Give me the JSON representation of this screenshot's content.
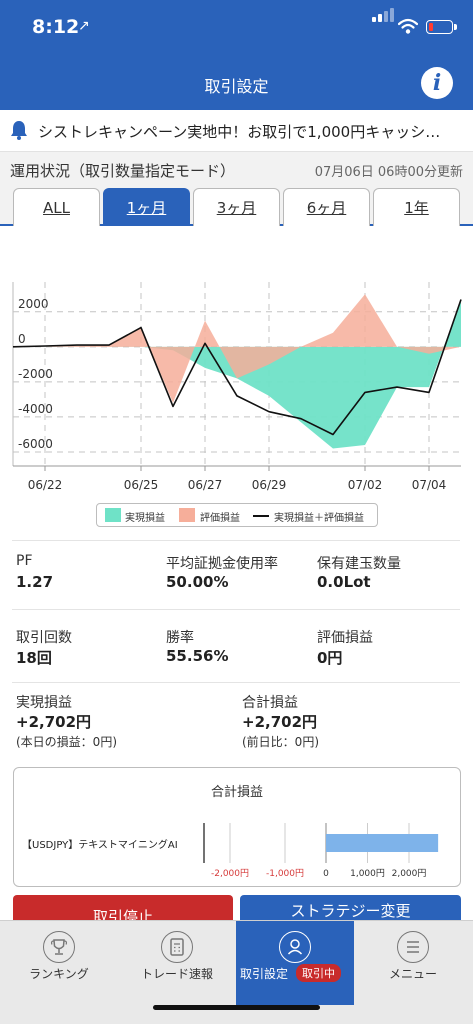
{
  "status_bar": {
    "time": "8:12",
    "location_glyph": "↗"
  },
  "header": {
    "title": "取引設定",
    "info_label": "i"
  },
  "ticker": {
    "text": "シストレキャンペーン実地中！お取引で1,000円キャッシ…"
  },
  "status_line": {
    "label": "運用状況（取引数量指定モード）",
    "updated": "07月06日 06時00分更新"
  },
  "tabs": [
    {
      "label": "ALL",
      "active": false
    },
    {
      "label": "1ヶ月",
      "active": true
    },
    {
      "label": "3ヶ月",
      "active": false
    },
    {
      "label": "6ヶ月",
      "active": false
    },
    {
      "label": "1年",
      "active": false
    }
  ],
  "chart_data": {
    "type": "area",
    "x": [
      "06/21",
      "06/22",
      "06/23",
      "06/24",
      "06/25",
      "06/26",
      "06/27",
      "06/28",
      "06/29",
      "06/30",
      "07/01",
      "07/02",
      "07/03",
      "07/04",
      "07/05"
    ],
    "x_ticks": [
      "06/22",
      "06/25",
      "06/27",
      "06/29",
      "07/02",
      "07/04"
    ],
    "y_ticks": [
      2000,
      0,
      -2000,
      -4000,
      -6000
    ],
    "ylim": [
      -6800,
      3700
    ],
    "grid": true,
    "legend_position": "bottom",
    "series": [
      {
        "name": "実現損益",
        "kind": "area",
        "color": "#6fe2c7",
        "values": [
          0,
          0,
          0,
          0,
          0,
          -200,
          -1200,
          -1800,
          -2800,
          -4300,
          -5800,
          -5600,
          -2300,
          -2300,
          2702
        ]
      },
      {
        "name": "評価損益",
        "kind": "area",
        "color": "#f6ae9a",
        "values": [
          0,
          0,
          50,
          100,
          1100,
          -3200,
          1500,
          -1800,
          -1000,
          0,
          800,
          3000,
          0,
          -400,
          0
        ]
      },
      {
        "name": "実現損益＋評価損益",
        "kind": "line",
        "color": "#111111",
        "values": [
          0,
          50,
          100,
          100,
          1100,
          -3400,
          200,
          -2800,
          -3700,
          -4100,
          -5000,
          -2600,
          -2300,
          -2600,
          2702
        ]
      }
    ]
  },
  "metrics": {
    "pf": {
      "label": "PF",
      "value": "1.27"
    },
    "margin_rate": {
      "label": "平均証拠金使用率",
      "value": "50.00%"
    },
    "position_qty": {
      "label": "保有建玉数量",
      "value": "0.0Lot"
    },
    "trade_count": {
      "label": "取引回数",
      "value": "18回"
    },
    "win_rate": {
      "label": "勝率",
      "value": "55.56%"
    },
    "unrealized": {
      "label": "評価損益",
      "value": "0円"
    },
    "realized": {
      "label": "実現損益",
      "value": "+2,702円",
      "sub": "(本日の損益：0円)"
    },
    "total": {
      "label": "合計損益",
      "value": "+2,702円",
      "sub": "(前日比：0円)"
    }
  },
  "total_panel": {
    "title": "合計損益",
    "strategy_label": "【USDJPY】テキストマイニングAI",
    "value": 2702,
    "bar_color": "#7eb3ea",
    "neg_ticks": [
      "-2,000円",
      "-1,000円"
    ],
    "pos_ticks": [
      "0",
      "1,000円",
      "2,000円"
    ]
  },
  "actions": {
    "stop_label": "取引停止",
    "strategy_change_label": "ストラテジー変更"
  },
  "bottom_nav": [
    {
      "label": "ランキング",
      "icon": "trophy-icon",
      "active": false
    },
    {
      "label": "トレード速報",
      "icon": "calculator-icon",
      "active": false
    },
    {
      "label": "取引設定",
      "icon": "user-icon",
      "active": true,
      "badge": "取引中"
    },
    {
      "label": "メニュー",
      "icon": "menu-icon",
      "active": false
    }
  ]
}
